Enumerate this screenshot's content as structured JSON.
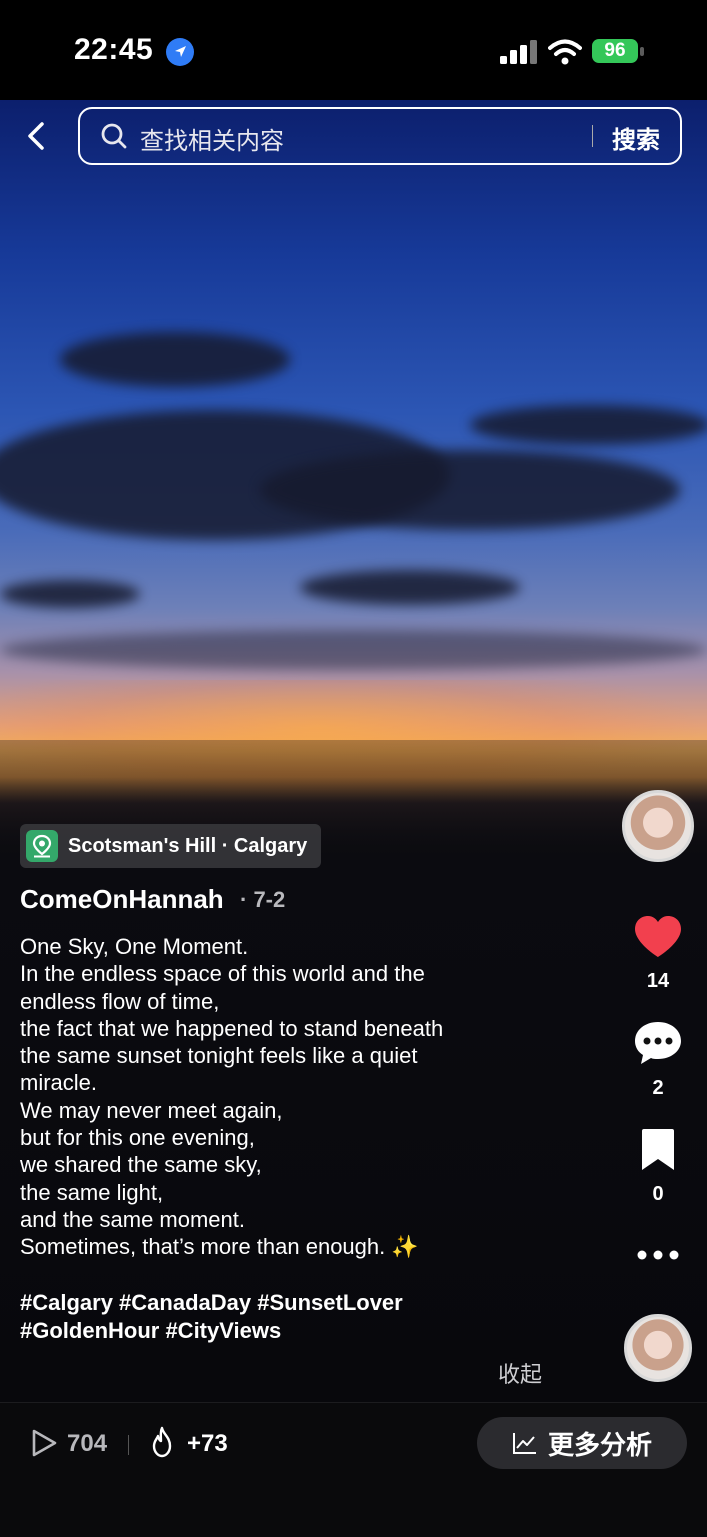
{
  "status_bar": {
    "time": "22:45",
    "battery": "96"
  },
  "search": {
    "placeholder": "查找相关内容",
    "button": "搜索"
  },
  "post": {
    "location": "Scotsman's Hill · Calgary",
    "author": "ComeOnHannah",
    "date": "· 7-2",
    "caption_lines": [
      "One Sky, One Moment.",
      "In the endless space of this world and the",
      "endless flow of time,",
      "the fact that we happened to stand beneath",
      "the same sunset tonight feels like a quiet",
      "miracle.",
      "We may never meet again,",
      "but for this one evening,",
      "we shared the same sky,",
      "the same light,",
      "and the same moment.",
      "Sometimes, that’s more than enough. ✨"
    ],
    "hashtags_line1": "#Calgary #CanadaDay #SunsetLover",
    "hashtags_line2": "#GoldenHour #CityViews",
    "collapse": "收起"
  },
  "rail": {
    "likes": "14",
    "comments": "2",
    "bookmarks": "0"
  },
  "bottom_bar": {
    "views": "704",
    "hot": "+73",
    "more_analysis": "更多分析"
  },
  "colors": {
    "like": "#f2404e",
    "location_chip": "#34a86a",
    "battery": "#34c759"
  }
}
